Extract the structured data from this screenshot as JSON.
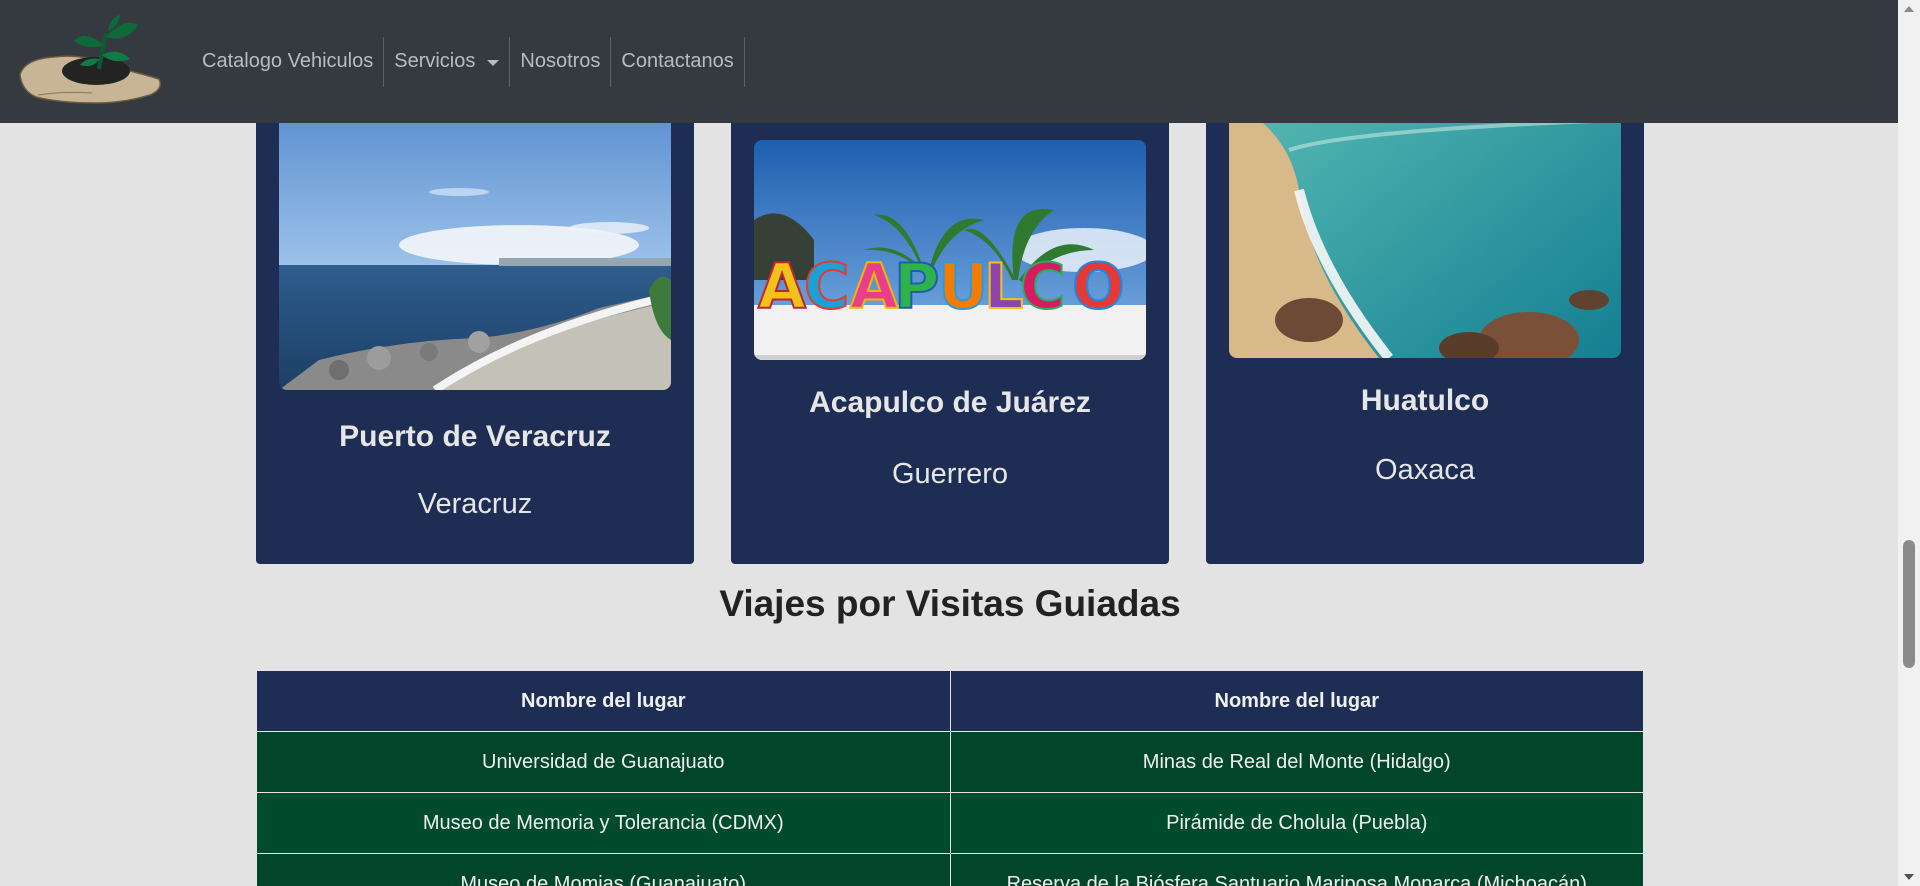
{
  "nav": {
    "items": [
      {
        "label": "Catalogo Vehiculos"
      },
      {
        "label": "Servicios"
      },
      {
        "label": "Nosotros"
      },
      {
        "label": "Contactanos"
      }
    ]
  },
  "cards": [
    {
      "title": "Puerto de Veracruz",
      "state": "Veracruz"
    },
    {
      "title": "Acapulco de Juárez",
      "state": "Guerrero",
      "sign_text": "ACAPULCO"
    },
    {
      "title": "Huatulco",
      "state": "Oaxaca"
    }
  ],
  "section": {
    "heading": "Viajes por Visitas Guiadas"
  },
  "table": {
    "headers": [
      "Nombre del lugar",
      "Nombre del lugar"
    ],
    "rows": [
      [
        "Universidad de Guanajuato",
        "Minas de Real del Monte (Hidalgo)"
      ],
      [
        "Museo de Memoria y Tolerancia (CDMX)",
        "Pirámide de Cholula (Puebla)"
      ],
      [
        "Museo de Momias (Guanajuato)",
        "Reserva de la Biósfera Santuario Mariposa Monarca (Michoacán)"
      ]
    ]
  },
  "colors": {
    "navbar": "#343a40",
    "card": "#1e2d54",
    "table_header": "#1e2d54",
    "table_cell": "#01462a",
    "page_bg": "#e3e3e3"
  },
  "scroll": {
    "position_fraction": 0.75
  }
}
